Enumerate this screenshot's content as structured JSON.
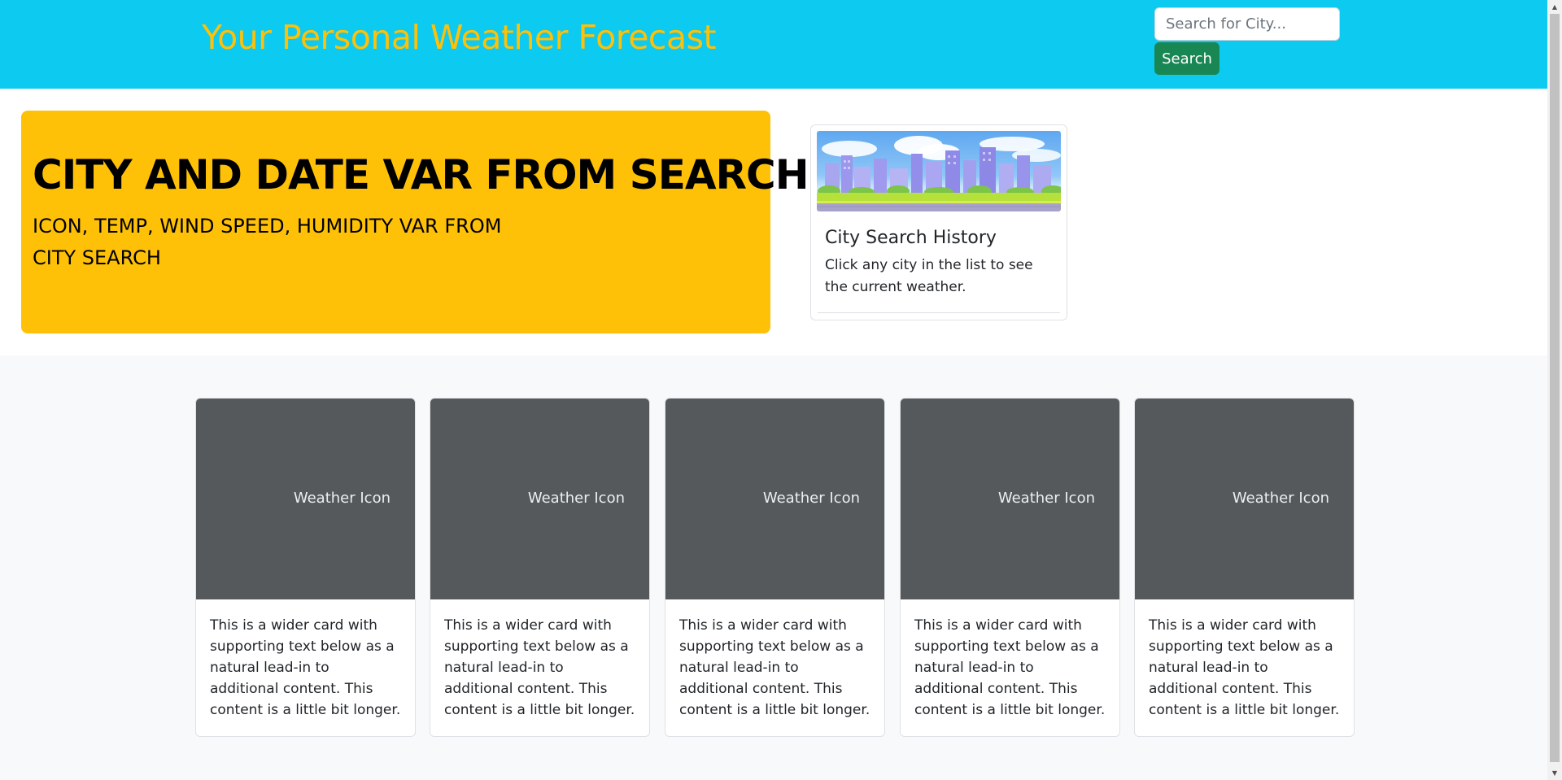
{
  "header": {
    "title": "Your Personal Weather Forecast",
    "search_placeholder": "Search for City...",
    "search_button_label": "Search"
  },
  "current": {
    "title": "CITY AND DATE VAR FROM SEARCH",
    "details": "ICON, TEMP, WIND SPEED, HUMIDITY VAR FROM CITY SEARCH"
  },
  "history": {
    "title": "City Search History",
    "text": "Click any city in the list to see the current weather."
  },
  "forecast": {
    "cards": [
      {
        "image_label": "Weather Icon",
        "text": "This is a wider card with supporting text below as a natural lead-in to additional content. This content is a little bit longer."
      },
      {
        "image_label": "Weather Icon",
        "text": "This is a wider card with supporting text below as a natural lead-in to additional content. This content is a little bit longer."
      },
      {
        "image_label": "Weather Icon",
        "text": "This is a wider card with supporting text below as a natural lead-in to additional content. This content is a little bit longer."
      },
      {
        "image_label": "Weather Icon",
        "text": "This is a wider card with supporting text below as a natural lead-in to additional content. This content is a little bit longer."
      },
      {
        "image_label": "Weather Icon",
        "text": "This is a wider card with supporting text below as a natural lead-in to additional content. This content is a little bit longer."
      }
    ]
  },
  "colors": {
    "header_bg": "#0dcaf0",
    "title_color": "#ffc107",
    "current_bg": "#ffc107",
    "search_button_bg": "#198754",
    "forecast_image_bg": "#55595c"
  }
}
